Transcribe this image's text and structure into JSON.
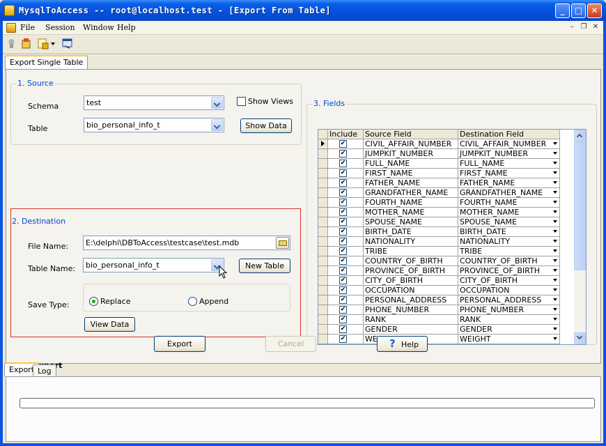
{
  "window": {
    "title": "MysqlToAccess -- root@localhost.test - [Export From Table]"
  },
  "menu": {
    "items": [
      "File",
      "Session",
      "Window",
      "Help"
    ]
  },
  "tabs": {
    "main": "Export Single Table",
    "bottom": [
      "Export",
      "Log"
    ]
  },
  "source": {
    "title": "1. Source",
    "schema_label": "Schema",
    "schema_value": "test",
    "show_views_label": "Show Views",
    "table_label": "Table",
    "table_value": "bio_personal_info_t",
    "show_data_label": "Show Data"
  },
  "destination": {
    "title": "2. Destination",
    "file_name_label": "File Name:",
    "file_name_value": "E:\\delphi\\DBToAccess\\testcase\\test.mdb",
    "table_name_label": "Table Name:",
    "table_name_value": "bio_personal_info_t",
    "new_table_label": "New Table",
    "save_type_label": "Save Type:",
    "replace_label": "Replace",
    "append_label": "Append",
    "save_type_selected": "Replace",
    "view_data_label": "View Data"
  },
  "fields": {
    "title": "3. Fields",
    "columns": [
      "Include",
      "Source Field",
      "Destination Field"
    ],
    "rows": [
      [
        "CIVIL_AFFAIR_NUMBER",
        "CIVIL_AFFAIR_NUMBER"
      ],
      [
        "JUMPKIT_NUMBER",
        "JUMPKIT_NUMBER"
      ],
      [
        "FULL_NAME",
        "FULL_NAME"
      ],
      [
        "FIRST_NAME",
        "FIRST_NAME"
      ],
      [
        "FATHER_NAME",
        "FATHER_NAME"
      ],
      [
        "GRANDFATHER_NAME",
        "GRANDFATHER_NAME"
      ],
      [
        "FOURTH_NAME",
        "FOURTH_NAME"
      ],
      [
        "MOTHER_NAME",
        "MOTHER_NAME"
      ],
      [
        "SPOUSE_NAME",
        "SPOUSE_NAME"
      ],
      [
        "BIRTH_DATE",
        "BIRTH_DATE"
      ],
      [
        "NATIONALITY",
        "NATIONALITY"
      ],
      [
        "TRIBE",
        "TRIBE"
      ],
      [
        "COUNTRY_OF_BIRTH",
        "COUNTRY_OF_BIRTH"
      ],
      [
        "PROVINCE_OF_BIRTH",
        "PROVINCE_OF_BIRTH"
      ],
      [
        "CITY_OF_BIRTH",
        "CITY_OF_BIRTH"
      ],
      [
        "OCCUPATION",
        "OCCUPATION"
      ],
      [
        "PERSONAL_ADDRESS",
        "PERSONAL_ADDRESS"
      ],
      [
        "PHONE_NUMBER",
        "PHONE_NUMBER"
      ],
      [
        "RANK",
        "RANK"
      ],
      [
        "GENDER",
        "GENDER"
      ],
      [
        "WEIGHT",
        "WEIGHT"
      ]
    ]
  },
  "export": {
    "title": "4. Export",
    "export_label": "Export",
    "cancel_label": "Cancel",
    "help_label": "Help"
  },
  "progress": {
    "value": 0
  }
}
